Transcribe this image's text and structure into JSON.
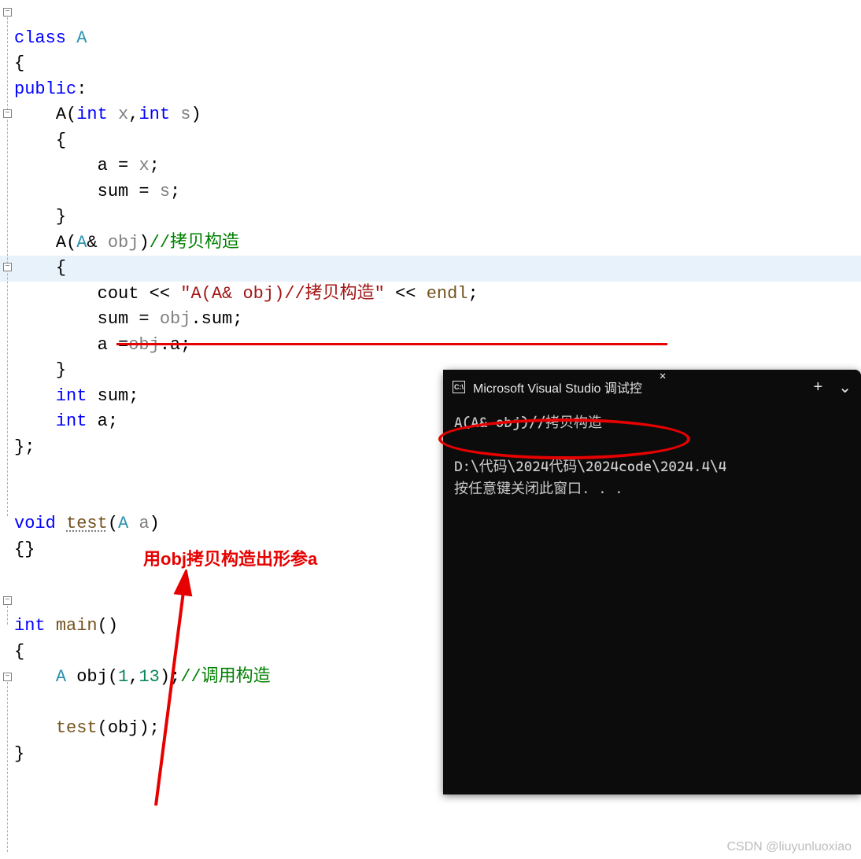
{
  "code": {
    "l1_class": "class",
    "l1_A": "A",
    "l2": "{",
    "l3_public": "public",
    "l3_colon": ":",
    "l4_A": "A",
    "l4_lp": "(",
    "l4_int1": "int",
    "l4_x": "x",
    "l4_comma": ",",
    "l4_int2": "int",
    "l4_s": "s",
    "l4_rp": ")",
    "l5": "{",
    "l6_a": "a",
    "l6_eq": " = ",
    "l6_x": "x",
    "l6_semi": ";",
    "l7_sum": "sum",
    "l7_eq": " = ",
    "l7_s": "s",
    "l7_semi": ";",
    "l8": "}",
    "l9_A": "A",
    "l9_lp": "(",
    "l9_Atype": "A",
    "l9_amp": "& ",
    "l9_obj": "obj",
    "l9_rp": ")",
    "l9_comment": "//拷贝构造",
    "l10": "{",
    "l11_cout": "cout",
    "l11_ins1": " << ",
    "l11_str": "\"A(A& obj)//拷贝构造\"",
    "l11_ins2": " << ",
    "l11_endl": "endl",
    "l11_semi": ";",
    "l12_sum": "sum",
    "l12_eq": " = ",
    "l12_obj": "obj",
    "l12_dot": ".",
    "l12_sum2": "sum",
    "l12_semi": ";",
    "l13_a": "a",
    "l13_eq": " =",
    "l13_obj": "obj",
    "l13_dot": ".",
    "l13_a2": "a",
    "l13_semi": ";",
    "l14": "}",
    "l15_int": "int",
    "l15_sum": "sum",
    "l15_semi": ";",
    "l16_int": "int",
    "l16_a": "a",
    "l16_semi": ";",
    "l17": "};",
    "l19_void": "void",
    "l19_test": "test",
    "l19_lp": "(",
    "l19_A": "A",
    "l19_a": "a",
    "l19_rp": ")",
    "l20": "{}",
    "l22_int": "int",
    "l22_main": "main",
    "l22_paren": "()",
    "l23": "{",
    "l24_A": "A",
    "l24_obj": "obj",
    "l24_lp": "(",
    "l24_1": "1",
    "l24_comma": ",",
    "l24_13": "13",
    "l24_rp": ")",
    "l24_semi": ";",
    "l24_comment": "//调用构造",
    "l26_test": "test",
    "l26_lp": "(",
    "l26_obj": "obj",
    "l26_rp": ")",
    "l26_semi": ";",
    "l27": "}"
  },
  "annotation": {
    "text": "用obj拷贝构造出形参a"
  },
  "terminal": {
    "tab_title": "Microsoft Visual Studio 调试控",
    "close": "✕",
    "plus": "+",
    "chevron": "⌄",
    "line1": "A(A& obj)//拷贝构造",
    "blank": "",
    "line2": "D:\\代码\\2024代码\\2024code\\2024.4\\4",
    "line3": "按任意键关闭此窗口. . ."
  },
  "watermark": "CSDN @liuyunluoxiao"
}
